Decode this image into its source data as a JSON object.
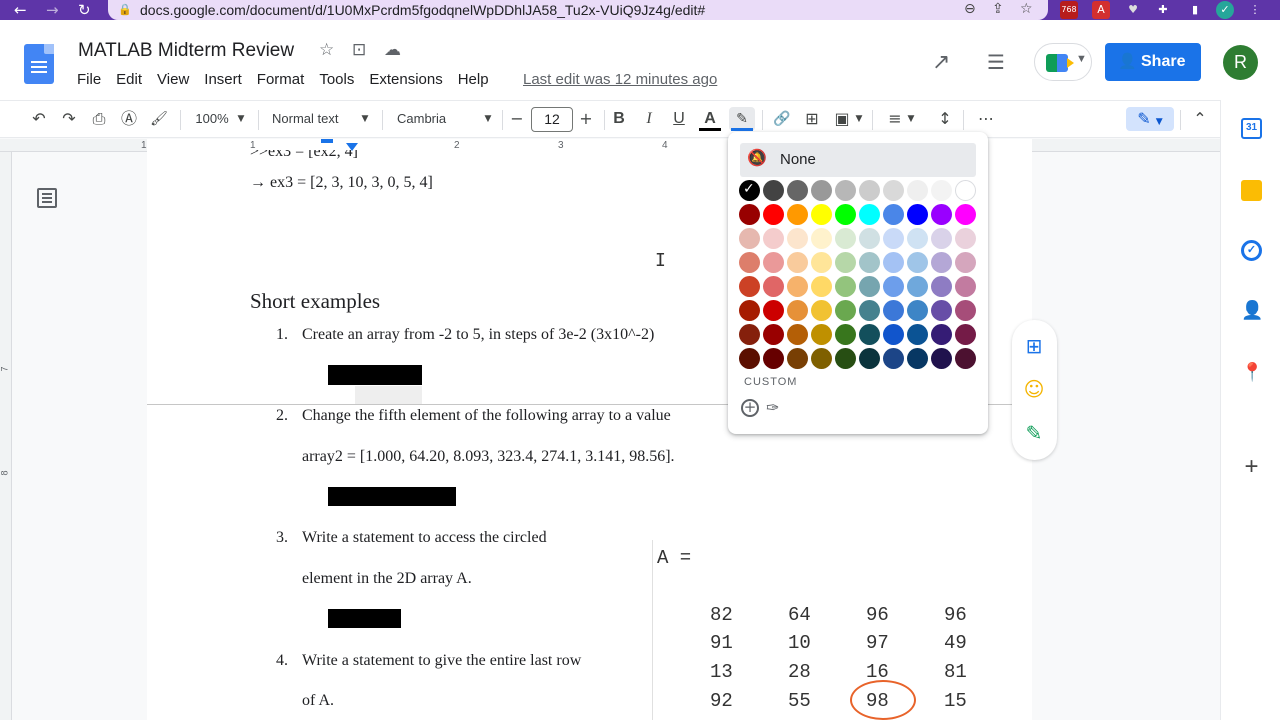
{
  "browser": {
    "back": "←",
    "forward": "→",
    "reload": "↻",
    "url": "docs.google.com/document/d/1U0MxPcrdm5fgodqnelWpDDhlJA58_Tu2x-VUiQ9Jz4g/edit#",
    "ext_badge": "768"
  },
  "header": {
    "doc_title": "MATLAB Midterm Review",
    "menus": [
      "File",
      "Edit",
      "View",
      "Insert",
      "Format",
      "Tools",
      "Extensions",
      "Help"
    ],
    "last_edit": "Last edit was 12 minutes ago",
    "share_label": "Share",
    "avatar_letter": "R"
  },
  "toolbar": {
    "zoom": "100%",
    "style": "Normal text",
    "font": "Cambria",
    "font_size": "12",
    "bold": "B",
    "italic": "I",
    "underline": "U",
    "text_color_letter": "A",
    "text_color": "#000000",
    "highlight_color": "#1a73e8",
    "more": "⋯"
  },
  "ruler": {
    "marks": [
      "1",
      "1",
      "2",
      "3",
      "4"
    ]
  },
  "vruler": {
    "marks": [
      "7",
      "8"
    ]
  },
  "document": {
    "line1": ">>ex3 = [ex2, 4]",
    "line2": "→ ex3 = [2, 3, 10, 3, 0, 5, 4]",
    "heading": "Short examples",
    "items": [
      {
        "num": "1.",
        "text": "Create an array from -2 to 5, in steps of 3e-2 (3x10^-2)"
      },
      {
        "num": "2.",
        "text": "Change the fifth element of the following array to a value",
        "text2": "array2 = [1.000, 64.20, 8.093, 323.4, 274.1, 3.141, 98.56]."
      },
      {
        "num": "3.",
        "text": "Write a statement to access the circled",
        "text2": "element in the 2D array A."
      },
      {
        "num": "4.",
        "text": "Write a statement to give the entire last row",
        "text2": "of A."
      }
    ],
    "matrix_label": "A  =",
    "matrix": [
      [
        "82",
        "64",
        "96",
        "96"
      ],
      [
        "91",
        "10",
        "97",
        "49"
      ],
      [
        "13",
        "28",
        "16",
        "81"
      ],
      [
        "92",
        "55",
        "98",
        "15"
      ]
    ]
  },
  "highlight_popup": {
    "none_label": "None",
    "custom_label": "CUSTOM",
    "colors": [
      [
        "#000000",
        "#434343",
        "#666666",
        "#999999",
        "#b7b7b7",
        "#cccccc",
        "#d9d9d9",
        "#efefef",
        "#f3f3f3",
        "#ffffff"
      ],
      [
        "#980000",
        "#ff0000",
        "#ff9900",
        "#ffff00",
        "#00ff00",
        "#00ffff",
        "#4a86e8",
        "#0000ff",
        "#9900ff",
        "#ff00ff"
      ],
      [
        "#e6b8af",
        "#f4cccc",
        "#fce5cd",
        "#fff2cc",
        "#d9ead3",
        "#d0e0e3",
        "#c9daf8",
        "#cfe2f3",
        "#d9d2e9",
        "#ead1dc"
      ],
      [
        "#dd7e6b",
        "#ea9999",
        "#f9cb9c",
        "#ffe599",
        "#b6d7a8",
        "#a2c4c9",
        "#a4c2f4",
        "#9fc5e8",
        "#b4a7d6",
        "#d5a6bd"
      ],
      [
        "#cc4125",
        "#e06666",
        "#f6b26b",
        "#ffd966",
        "#93c47d",
        "#76a5af",
        "#6d9eeb",
        "#6fa8dc",
        "#8e7cc3",
        "#c27ba0"
      ],
      [
        "#a61c00",
        "#cc0000",
        "#e69138",
        "#f1c232",
        "#6aa84f",
        "#45818e",
        "#3c78d8",
        "#3d85c6",
        "#674ea7",
        "#a64d79"
      ],
      [
        "#85200c",
        "#990000",
        "#b45f06",
        "#bf9000",
        "#38761d",
        "#134f5c",
        "#1155cc",
        "#0b5394",
        "#351c75",
        "#741b47"
      ],
      [
        "#5b0f00",
        "#660000",
        "#783f04",
        "#7f6000",
        "#274e13",
        "#0c343d",
        "#1c4587",
        "#073763",
        "#20124d",
        "#4c1130"
      ]
    ]
  },
  "icons": {
    "star": "☆",
    "move": "⊡",
    "cloud": "☁",
    "trend": "↗",
    "comments": "☰",
    "undo": "↶",
    "redo": "↷",
    "print": "⎙",
    "spell": "Ⓐ",
    "paint": "🖌",
    "link": "🔗",
    "comment_add": "⊞",
    "image": "▣",
    "align": "≡",
    "spacing": "↕",
    "pencil": "✎",
    "collapse": "⌃",
    "plus": "+",
    "minus": "−",
    "bell_off": "🔕",
    "eyedropper": "✑",
    "emoji": "☺",
    "suggest": "✎",
    "side_add": "+"
  }
}
